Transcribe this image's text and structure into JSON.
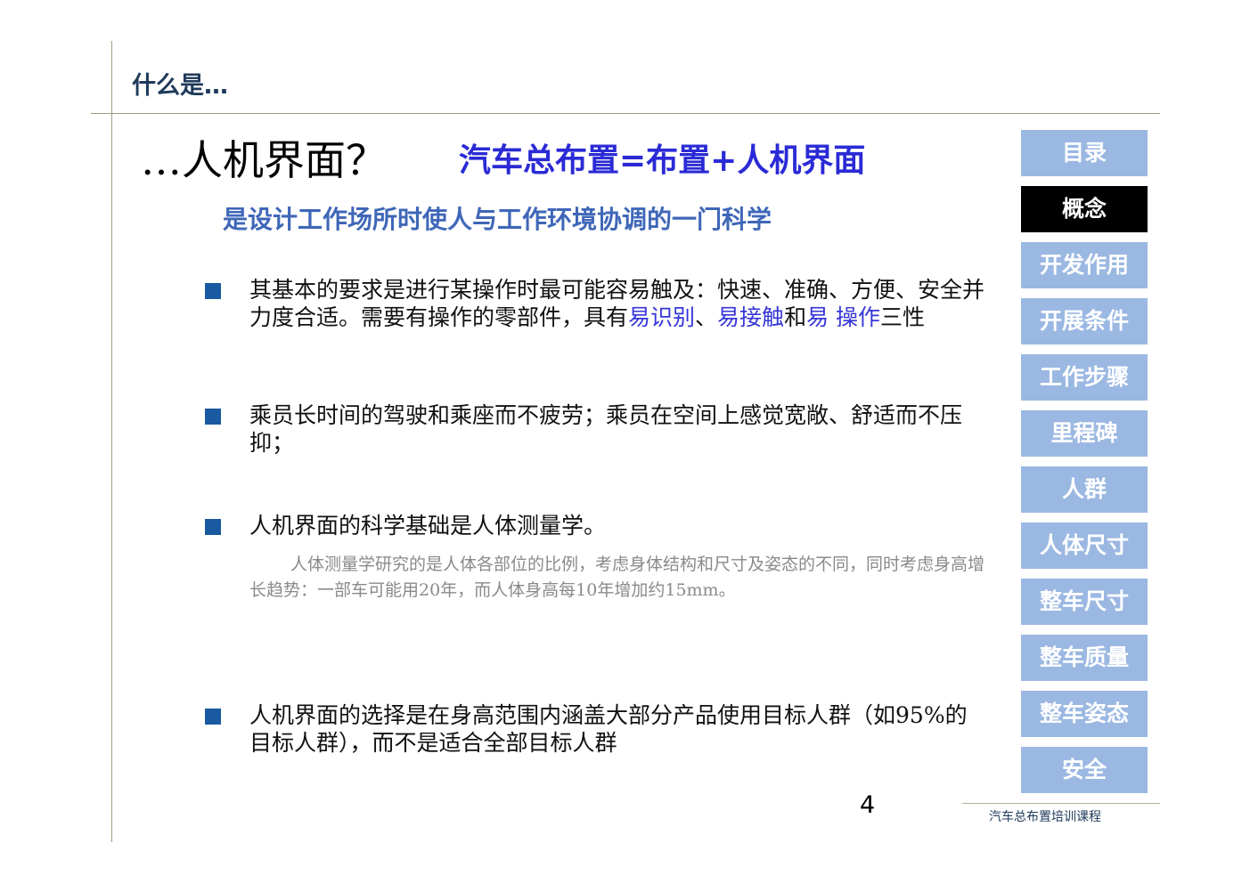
{
  "header": {
    "section_title": "什么是…"
  },
  "title": {
    "main": "…人机界面？",
    "formula": "汽车总布置=布置+人机界面"
  },
  "subtitle": "是设计工作场所时使人与工作环境协调的一门科学",
  "bullets": [
    {
      "part1": "其基本的要求是进行某操作时最可能容易触及：快速、准确、方便、安全并力度合适。需要有操作的零部件，具有",
      "hl1": "易识别",
      "part2": "、",
      "hl2": "易接触",
      "part3": "和",
      "hl3": "易 操作",
      "part4": "三性"
    },
    {
      "text": "乘员长时间的驾驶和乘座而不疲劳；乘员在空间上感觉宽敞、舒适而不压抑；"
    },
    {
      "text": "人机界面的科学基础是人体测量学。",
      "note": "人体测量学研究的是人体各部位的比例，考虑身体结构和尺寸及姿态的不同，同时考虑身高增长趋势：一部车可能用20年，而人体身高每10年增加约15mm。"
    },
    {
      "text": "人机界面的选择是在身高范围内涵盖大部分产品使用目标人群（如95%的目标人群），而不是适合全部目标人群"
    }
  ],
  "nav": {
    "items": [
      {
        "label": "目录"
      },
      {
        "label": "概念",
        "active": true
      },
      {
        "label": "开发作用"
      },
      {
        "label": "开展条件"
      },
      {
        "label": "工作步骤"
      },
      {
        "label": "里程碑"
      },
      {
        "label": "人群"
      },
      {
        "label": "人体尺寸"
      },
      {
        "label": "整车尺寸"
      },
      {
        "label": "整车质量"
      },
      {
        "label": "整车姿态"
      },
      {
        "label": "安全"
      }
    ]
  },
  "footer": {
    "page_number": "4",
    "course": "汽车总布置培训课程"
  },
  "colors": {
    "nav_bg": "#9bb8e2",
    "nav_active": "#000000",
    "bullet": "#1a5aa0",
    "highlight": "#3535d8",
    "formula": "#2a2ad6",
    "subtitle": "#3f67b8"
  }
}
